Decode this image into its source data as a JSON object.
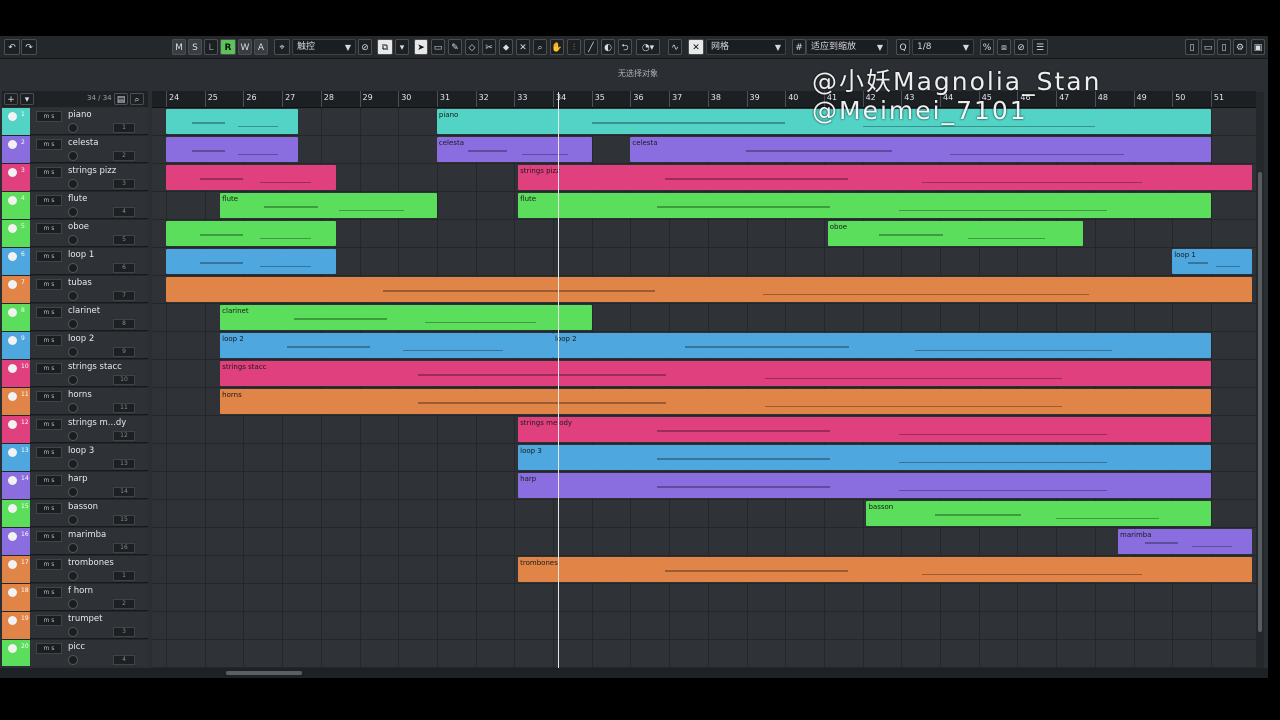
{
  "toolbar": {
    "undo_icon": "undo-icon",
    "redo_icon": "redo-icon",
    "buttons": [
      "M",
      "S",
      "L",
      "R",
      "W",
      "A"
    ],
    "touch_mode": "触控",
    "grid_label": "网格",
    "snap_label": "适应到缩放",
    "quantize": "1/8"
  },
  "status_text": "无选择对象",
  "watermark": {
    "line1": "@小妖Magnolia_Stan",
    "line2": "@Meimei_7101"
  },
  "track_count": "34 / 34",
  "ruler": [
    "24",
    "25",
    "26",
    "27",
    "28",
    "29",
    "30",
    "31",
    "32",
    "33",
    "34",
    "35",
    "36",
    "37",
    "38",
    "39",
    "40",
    "41",
    "42",
    "43",
    "44",
    "45",
    "46",
    "47",
    "48",
    "49",
    "50",
    "51"
  ],
  "tracks": [
    {
      "num": "1",
      "name": "piano",
      "color": "#52d3c6",
      "ch": "1"
    },
    {
      "num": "2",
      "name": "celesta",
      "color": "#8a6ee0",
      "ch": "2"
    },
    {
      "num": "3",
      "name": "strings pizz",
      "color": "#e0407e",
      "ch": "3"
    },
    {
      "num": "4",
      "name": "flute",
      "color": "#5bde5b",
      "ch": "4"
    },
    {
      "num": "5",
      "name": "oboe",
      "color": "#5bde5b",
      "ch": "5"
    },
    {
      "num": "6",
      "name": "loop 1",
      "color": "#4ea7df",
      "ch": "6"
    },
    {
      "num": "7",
      "name": "tubas",
      "color": "#e08448",
      "ch": "7"
    },
    {
      "num": "8",
      "name": "clarinet",
      "color": "#5bde5b",
      "ch": "8"
    },
    {
      "num": "9",
      "name": "loop 2",
      "color": "#4ea7df",
      "ch": "9"
    },
    {
      "num": "10",
      "name": "strings stacc",
      "color": "#e0407e",
      "ch": "10"
    },
    {
      "num": "11",
      "name": "horns",
      "color": "#e08448",
      "ch": "11"
    },
    {
      "num": "12",
      "name": "strings m...dy",
      "color": "#e0407e",
      "ch": "12"
    },
    {
      "num": "13",
      "name": "loop 3",
      "color": "#4ea7df",
      "ch": "13"
    },
    {
      "num": "14",
      "name": "harp",
      "color": "#8a6ee0",
      "ch": "14"
    },
    {
      "num": "15",
      "name": "basson",
      "color": "#5bde5b",
      "ch": "15"
    },
    {
      "num": "16",
      "name": "marimba",
      "color": "#8a6ee0",
      "ch": "16"
    },
    {
      "num": "17",
      "name": "trombones",
      "color": "#e08448",
      "ch": "1"
    },
    {
      "num": "18",
      "name": "f horn",
      "color": "#e08448",
      "ch": "2"
    },
    {
      "num": "19",
      "name": "trumpet",
      "color": "#e08448",
      "ch": "3"
    },
    {
      "num": "20",
      "name": "picc",
      "color": "#5bde5b",
      "ch": "4"
    }
  ],
  "parts": [
    {
      "row": 0,
      "start": 24,
      "end": 27.4,
      "label": "",
      "color": "#52d3c6"
    },
    {
      "row": 0,
      "start": 31,
      "end": 51,
      "label": "piano",
      "color": "#52d3c6"
    },
    {
      "row": 1,
      "start": 24,
      "end": 27.4,
      "label": "",
      "color": "#8a6ee0"
    },
    {
      "row": 1,
      "start": 31,
      "end": 35,
      "label": "celesta",
      "color": "#8a6ee0"
    },
    {
      "row": 1,
      "start": 36,
      "end": 51,
      "label": "celesta",
      "color": "#8a6ee0"
    },
    {
      "row": 2,
      "start": 24,
      "end": 28.4,
      "label": "",
      "color": "#e0407e"
    },
    {
      "row": 2,
      "start": 33.1,
      "end": 52.1,
      "label": "strings pizz",
      "color": "#e0407e"
    },
    {
      "row": 3,
      "start": 25.4,
      "end": 31,
      "label": "flute",
      "color": "#5bde5b"
    },
    {
      "row": 3,
      "start": 33.1,
      "end": 51,
      "label": "flute",
      "color": "#5bde5b"
    },
    {
      "row": 4,
      "start": 24,
      "end": 28.4,
      "label": "",
      "color": "#5bde5b"
    },
    {
      "row": 4,
      "start": 41.1,
      "end": 47.7,
      "label": "oboe",
      "color": "#5bde5b"
    },
    {
      "row": 5,
      "start": 24,
      "end": 28.4,
      "label": "",
      "color": "#4ea7df"
    },
    {
      "row": 5,
      "start": 50,
      "end": 52.1,
      "label": "loop 1",
      "color": "#4ea7df"
    },
    {
      "row": 6,
      "start": 24,
      "end": 52.1,
      "label": "",
      "color": "#e08448"
    },
    {
      "row": 7,
      "start": 25.4,
      "end": 35,
      "label": "clarinet",
      "color": "#5bde5b"
    },
    {
      "row": 8,
      "start": 25.4,
      "end": 34,
      "label": "loop 2",
      "color": "#4ea7df"
    },
    {
      "row": 8,
      "start": 34,
      "end": 51,
      "label": "loop 2",
      "color": "#4ea7df"
    },
    {
      "row": 9,
      "start": 25.4,
      "end": 51,
      "label": "strings stacc",
      "color": "#e0407e"
    },
    {
      "row": 10,
      "start": 25.4,
      "end": 51,
      "label": "horns",
      "color": "#e08448"
    },
    {
      "row": 11,
      "start": 33.1,
      "end": 51,
      "label": "strings melody",
      "color": "#e0407e"
    },
    {
      "row": 12,
      "start": 33.1,
      "end": 51,
      "label": "loop 3",
      "color": "#4ea7df"
    },
    {
      "row": 13,
      "start": 33.1,
      "end": 51,
      "label": "harp",
      "color": "#8a6ee0"
    },
    {
      "row": 14,
      "start": 42.1,
      "end": 51,
      "label": "basson",
      "color": "#5bde5b"
    },
    {
      "row": 15,
      "start": 48.6,
      "end": 52.1,
      "label": "marimba",
      "color": "#8a6ee0"
    },
    {
      "row": 16,
      "start": 33.1,
      "end": 52.1,
      "label": "trombones",
      "color": "#e08448"
    }
  ]
}
